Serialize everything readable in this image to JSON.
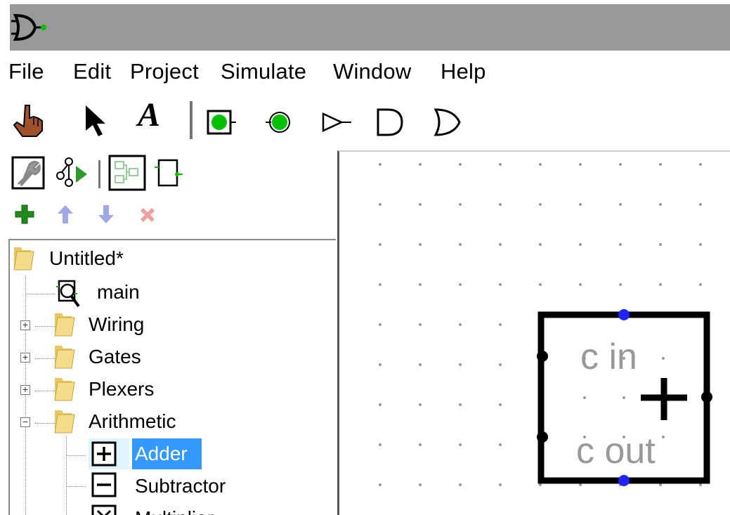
{
  "menu": {
    "items": [
      "File",
      "Edit",
      "Project",
      "Simulate",
      "Window",
      "Help"
    ]
  },
  "toolbar": {
    "tools": [
      "hand-icon",
      "arrow-pointer-icon",
      "text-tool-icon",
      "input-pin-icon",
      "output-pin-icon",
      "buffer-icon",
      "and-gate-icon",
      "or-gate-icon"
    ],
    "text_tool_label": "A"
  },
  "explorer": {
    "project_name": "Untitled*",
    "items": [
      {
        "label": "main",
        "icon": "circuit-magnifier-icon"
      },
      {
        "label": "Wiring",
        "icon": "folder-icon"
      },
      {
        "label": "Gates",
        "icon": "folder-icon"
      },
      {
        "label": "Plexers",
        "icon": "folder-icon"
      },
      {
        "label": "Arithmetic",
        "icon": "folder-icon"
      },
      {
        "label": "Adder",
        "icon": "adder-icon"
      },
      {
        "label": "Subtractor",
        "icon": "subtractor-icon"
      },
      {
        "label": "Multiplier",
        "icon": "multiplier-icon"
      }
    ],
    "selected": "Adder"
  },
  "component": {
    "type": "Adder",
    "label_cin": "c in",
    "label_cout": "c out",
    "symbol": "+"
  },
  "colors": {
    "titlebar": "#999999",
    "selection": "#3399ff",
    "pin_green": "#00c000",
    "port_blue": "#2222ff",
    "add_green": "#1f8a1f",
    "disabled_blue": "#a0a8e8",
    "disabled_red": "#f0a0a0"
  }
}
